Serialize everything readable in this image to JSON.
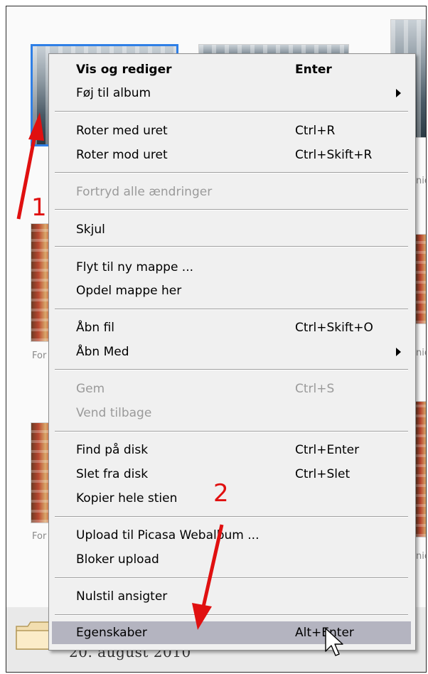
{
  "background": {
    "thumb_captions": [
      "For",
      "For",
      "nic",
      "nic",
      "nic"
    ],
    "folder_date": "20. august 2010",
    "icons": [
      "folder-icon",
      "mouse-cursor-icon"
    ]
  },
  "menu": {
    "items": [
      {
        "label": "Vis og rediger",
        "shortcut": "Enter"
      },
      {
        "label": "Føj til album",
        "shortcut": ""
      },
      {
        "label": "Roter med uret",
        "shortcut": "Ctrl+R"
      },
      {
        "label": "Roter mod uret",
        "shortcut": "Ctrl+Skift+R"
      },
      {
        "label": "Fortryd alle ændringer",
        "shortcut": ""
      },
      {
        "label": "Skjul",
        "shortcut": ""
      },
      {
        "label": "Flyt til ny mappe ...",
        "shortcut": ""
      },
      {
        "label": "Opdel mappe her",
        "shortcut": ""
      },
      {
        "label": "Åbn fil",
        "shortcut": "Ctrl+Skift+O"
      },
      {
        "label": "Åbn Med",
        "shortcut": ""
      },
      {
        "label": "Gem",
        "shortcut": "Ctrl+S"
      },
      {
        "label": "Vend tilbage",
        "shortcut": ""
      },
      {
        "label": "Find på disk",
        "shortcut": "Ctrl+Enter"
      },
      {
        "label": "Slet fra disk",
        "shortcut": "Ctrl+Slet"
      },
      {
        "label": "Kopier hele stien",
        "shortcut": ""
      },
      {
        "label": "Upload til Picasa Webalbum ...",
        "shortcut": ""
      },
      {
        "label": "Bloker upload",
        "shortcut": ""
      },
      {
        "label": "Nulstil ansigter",
        "shortcut": ""
      },
      {
        "label": "Egenskaber",
        "shortcut": "Alt+Enter"
      }
    ],
    "highlighted_item": "Egenskaber"
  },
  "annotations": {
    "label_1": "1",
    "label_2": "2",
    "color": "#e01010"
  },
  "colors": {
    "selection_border": "#2f7fe6",
    "menu_background": "#f0f0f0",
    "highlight": "#b4b4c0"
  }
}
